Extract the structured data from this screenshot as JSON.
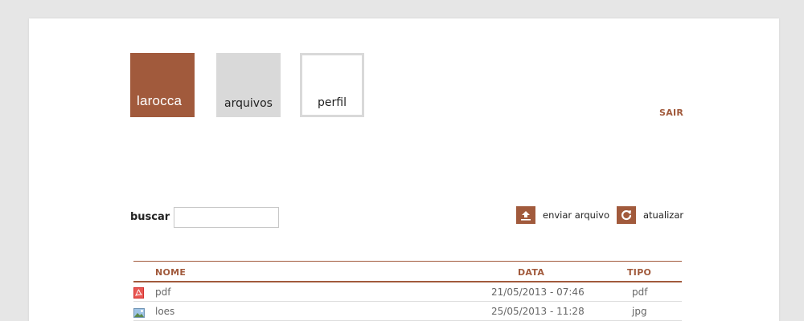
{
  "nav": {
    "logo": "larocca",
    "files": "arquivos",
    "profile": "perfil",
    "logout": "SAIR"
  },
  "search": {
    "label": "buscar",
    "value": ""
  },
  "actions": {
    "upload": "enviar arquivo",
    "refresh": "atualizar"
  },
  "colors": {
    "accent": "#a15a3c",
    "tile_gray": "#d9d9d9"
  },
  "table": {
    "columns": [
      "NOME",
      "DATA",
      "TIPO"
    ],
    "rows": [
      {
        "icon": "pdf-file-icon",
        "name": "pdf",
        "date": "21/05/2013 - 07:46",
        "type": "pdf"
      },
      {
        "icon": "image-file-icon",
        "name": "loes",
        "date": "25/05/2013 - 11:28",
        "type": "jpg"
      }
    ]
  }
}
